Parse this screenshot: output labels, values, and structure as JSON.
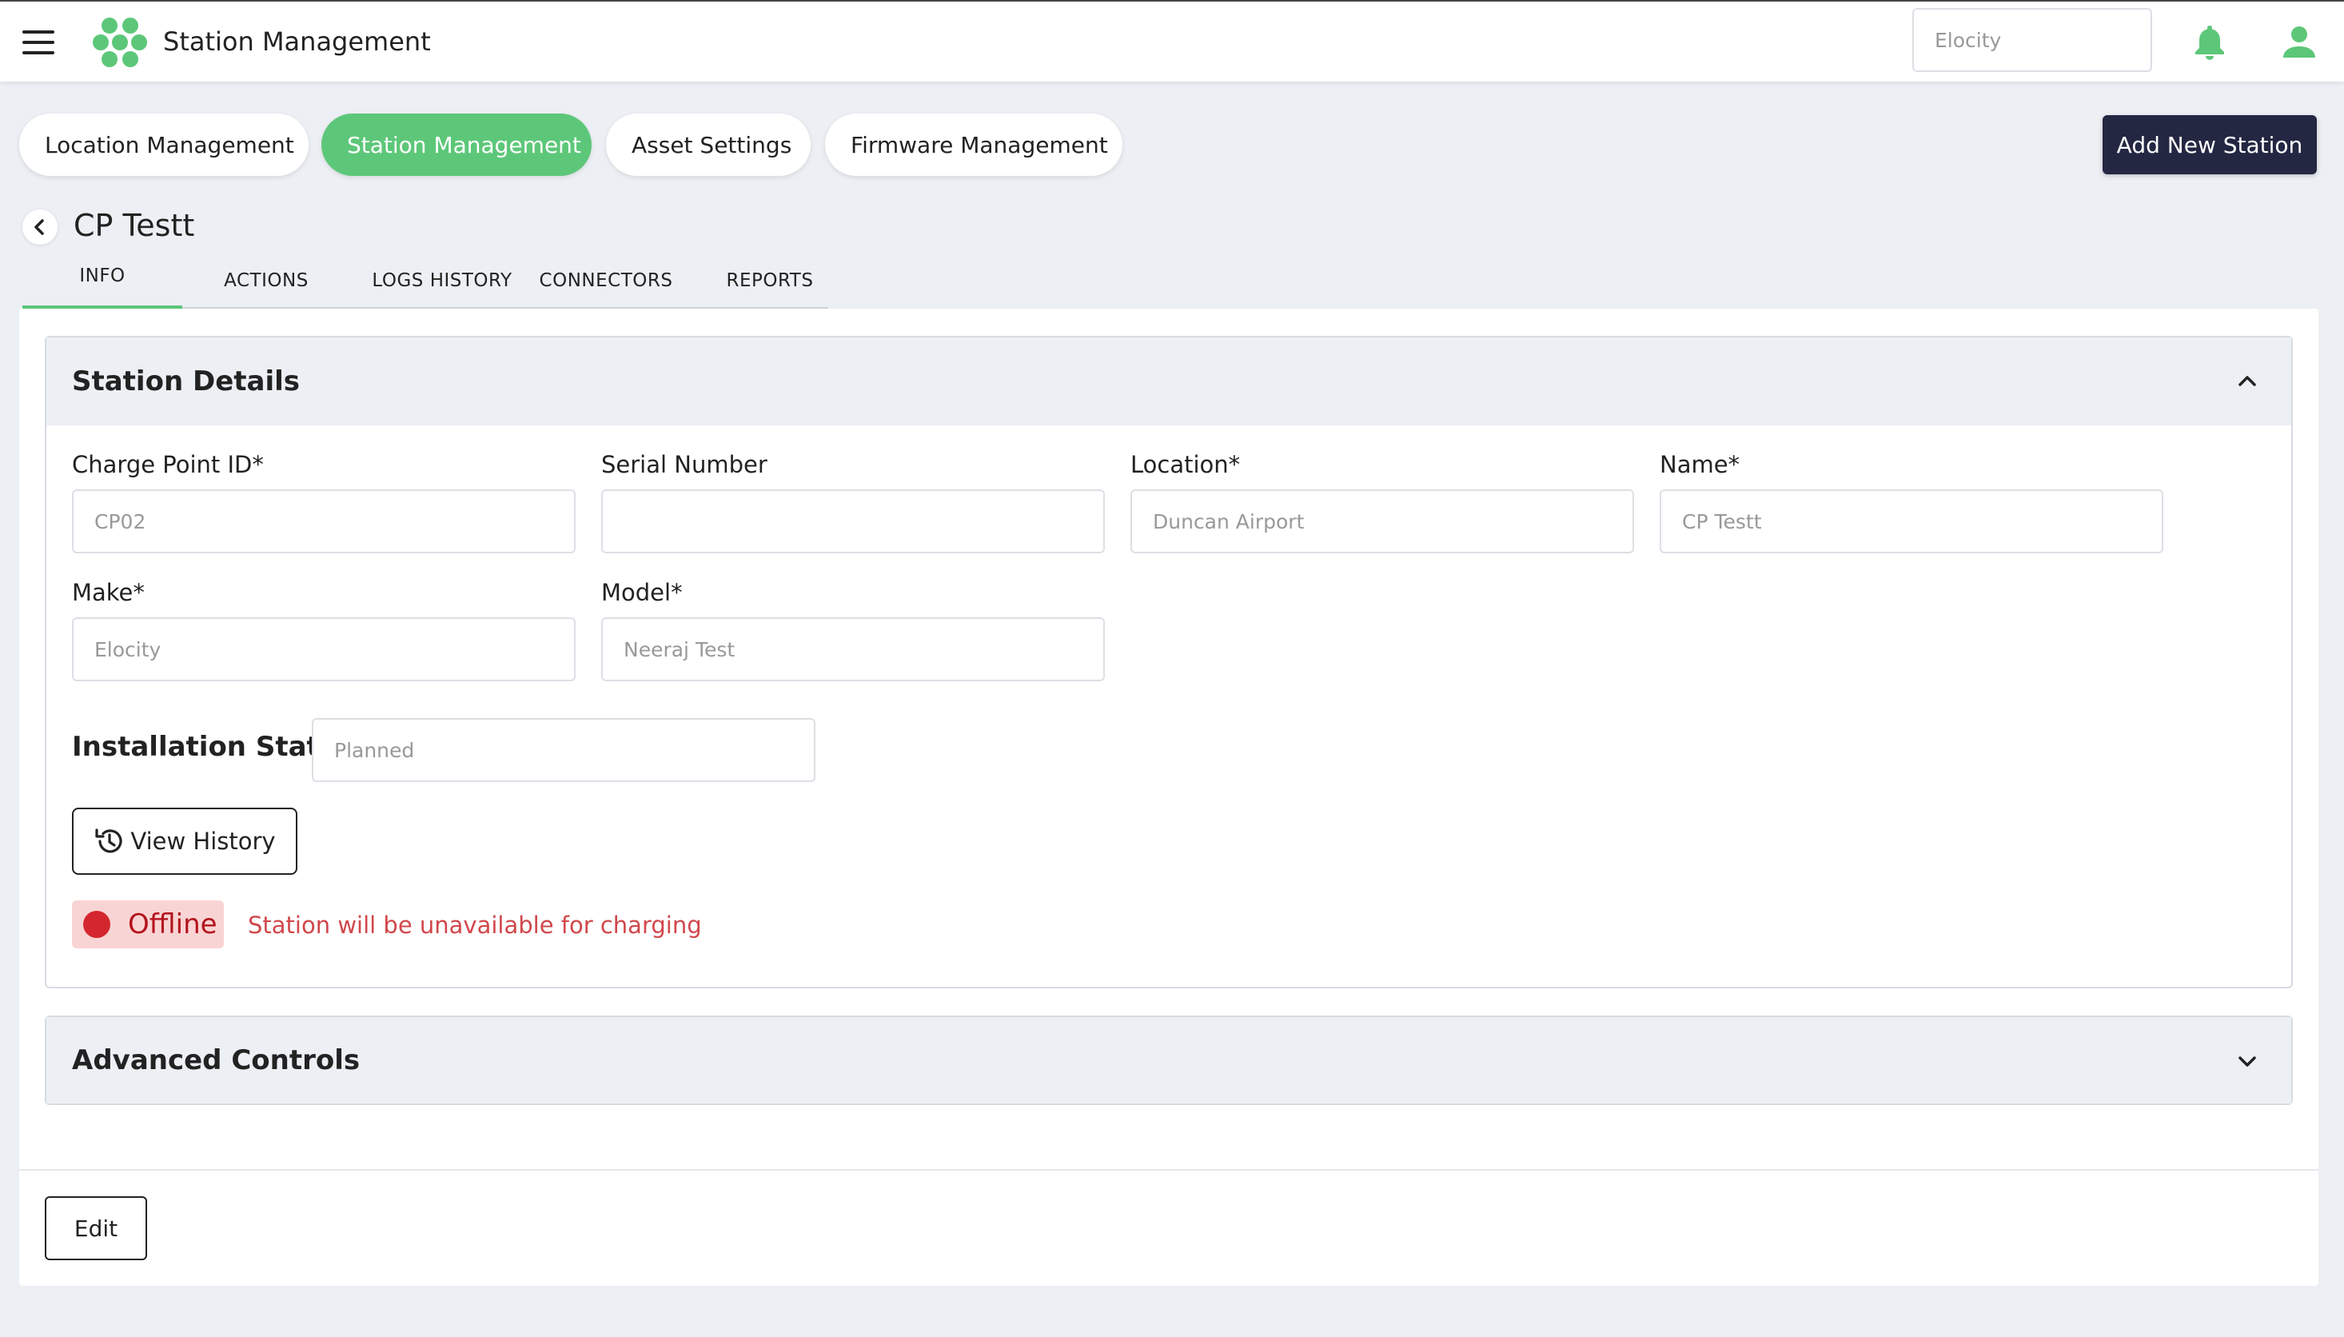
{
  "header": {
    "title": "Station Management",
    "tenant_placeholder": "Elocity",
    "icons": {
      "menu": "hamburger-menu-icon",
      "logo": "hexagon-cluster-logo",
      "notifications": "bell-icon",
      "user": "user-icon"
    },
    "accent_color": "#5dc779"
  },
  "nav": {
    "pills": [
      {
        "label": "Location Management",
        "active": false
      },
      {
        "label": "Station Management",
        "active": true
      },
      {
        "label": "Asset Settings",
        "active": false
      },
      {
        "label": "Firmware Management",
        "active": false
      }
    ],
    "add_button": "Add New Station"
  },
  "page": {
    "title": "CP Testt",
    "tabs": [
      "INFO",
      "ACTIONS",
      "LOGS HISTORY",
      "CONNECTORS",
      "REPORTS"
    ],
    "active_tab": "INFO"
  },
  "station_details": {
    "title": "Station Details",
    "expanded": true,
    "fields": {
      "charge_point_id": {
        "label": "Charge Point ID*",
        "placeholder": "CP02"
      },
      "serial_number": {
        "label": "Serial Number",
        "placeholder": ""
      },
      "location": {
        "label": "Location*",
        "placeholder": "Duncan Airport"
      },
      "name": {
        "label": "Name*",
        "placeholder": "CP Testt"
      },
      "make": {
        "label": "Make*",
        "placeholder": "Elocity"
      },
      "model": {
        "label": "Model*",
        "placeholder": "Neeraj Test"
      }
    },
    "installation_state": {
      "label": "Installation State :",
      "placeholder": "Planned"
    },
    "view_history_label": "View History",
    "status": {
      "label": "Offline",
      "message": "Station will be unavailable for charging",
      "color": "#d4262e"
    }
  },
  "advanced_controls": {
    "title": "Advanced Controls",
    "expanded": false
  },
  "footer": {
    "edit_label": "Edit"
  }
}
